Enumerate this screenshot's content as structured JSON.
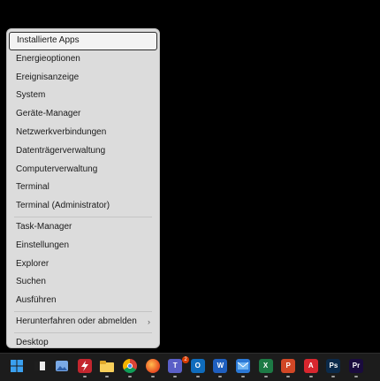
{
  "menu": {
    "items": [
      {
        "label": "Installierte Apps"
      },
      {
        "label": "Energieoptionen"
      },
      {
        "label": "Ereignisanzeige"
      },
      {
        "label": "System"
      },
      {
        "label": "Geräte-Manager"
      },
      {
        "label": "Netzwerkverbindungen"
      },
      {
        "label": "Datenträgerverwaltung"
      },
      {
        "label": "Computerverwaltung"
      },
      {
        "label": "Terminal"
      },
      {
        "label": "Terminal (Administrator)"
      },
      {
        "label": "Task-Manager"
      },
      {
        "label": "Einstellungen"
      },
      {
        "label": "Explorer"
      },
      {
        "label": "Suchen"
      },
      {
        "label": "Ausführen"
      },
      {
        "label": "Herunterfahren oder abmelden",
        "chevron": "›"
      },
      {
        "label": "Desktop"
      }
    ]
  },
  "taskbar": {
    "teams_badge": "2",
    "icons": [
      {
        "name": "windows-start-icon",
        "color": "#2f8fe0"
      },
      {
        "name": "widgets-icon",
        "color": "#e0e0e0"
      },
      {
        "name": "photos-icon",
        "color": "#5b8fd9"
      },
      {
        "name": "flash-app-icon",
        "color": "#c4262e"
      },
      {
        "name": "file-explorer-icon",
        "color": "#f2c443"
      },
      {
        "name": "chrome-icon",
        "color": "#e8b517"
      },
      {
        "name": "firefox-icon",
        "color": "#e86b1f"
      },
      {
        "name": "teams-icon",
        "color": "#5a5fc7",
        "text": "T"
      },
      {
        "name": "outlook-icon",
        "color": "#0f6cbd",
        "text": "O"
      },
      {
        "name": "word-icon",
        "color": "#1f5fbf",
        "text": "W"
      },
      {
        "name": "mail-icon",
        "color": "#2b79d6"
      },
      {
        "name": "excel-icon",
        "color": "#1d7a45",
        "text": "X"
      },
      {
        "name": "powerpoint-icon",
        "color": "#d24726",
        "text": "P"
      },
      {
        "name": "acrobat-icon",
        "color": "#d7262e",
        "text": "A"
      },
      {
        "name": "photoshop-icon",
        "color": "#0b2a4a",
        "text": "Ps"
      },
      {
        "name": "premiere-icon",
        "color": "#1a0b3e",
        "text": "Pr"
      }
    ]
  }
}
